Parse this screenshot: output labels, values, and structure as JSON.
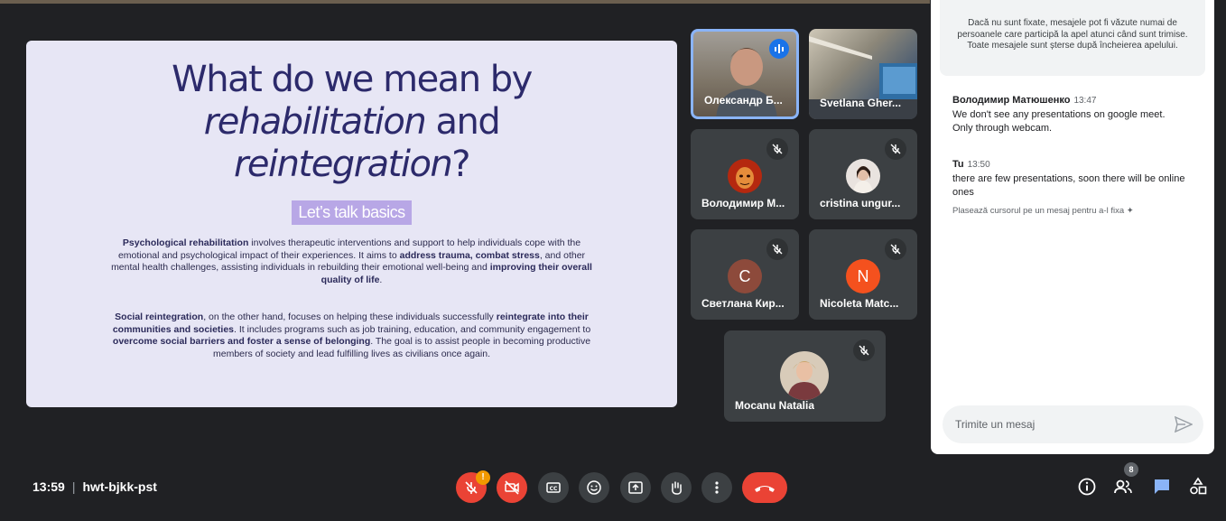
{
  "slide": {
    "title_line1": "What do we mean by",
    "title_line2_italic": "rehabilitation",
    "title_line2_rest": " and",
    "title_line3_italic": "reintegration",
    "title_line3_rest": "?",
    "subtitle": "Let’s talk basics",
    "p1": {
      "b1": "Psychological rehabilitation",
      "t1": " involves therapeutic interventions and support to help individuals cope with the emotional and psychological impact of their experiences. It aims to ",
      "b2": "address trauma, combat stress",
      "t2": ", and other mental health challenges, assisting individuals in rebuilding their emotional well-being and ",
      "b3": "improving their overall quality of life",
      "t3": "."
    },
    "p2": {
      "b1": "Social reintegration",
      "t1": ", on the other hand, focuses on helping these individuals successfully ",
      "b2": "reintegrate into their communities and societies",
      "t2": ". It includes programs such as job training, education, and community engagement to ",
      "b3": "overcome social barriers and foster a sense of belonging",
      "t3": ". The goal is to assist people in becoming productive members of society and lead fulfilling lives as civilians once again."
    }
  },
  "participants": [
    {
      "name": "Олександр Б...",
      "type": "video",
      "speaking": true
    },
    {
      "name": "Svetlana Gher...",
      "type": "video"
    },
    {
      "name": "Володимир М...",
      "type": "photo",
      "muted": true
    },
    {
      "name": "cristina ungur...",
      "type": "photo",
      "muted": true
    },
    {
      "name": "Светлана Кир...",
      "type": "initial",
      "initial": "C",
      "color": "#8d4a3b",
      "muted": true
    },
    {
      "name": "Nicoleta Matc...",
      "type": "initial",
      "initial": "N",
      "color": "#f4511e",
      "muted": true
    },
    {
      "name": "Mocanu Natalia",
      "type": "photo",
      "muted": true
    }
  ],
  "chat": {
    "notice": "Dacă nu sunt fixate, mesajele pot fi văzute numai de persoanele care participă la apel atunci când sunt trimise. Toate mesajele sunt șterse după încheierea apelului.",
    "messages": [
      {
        "sender": "Володимир Матюшенко",
        "time": "13:47",
        "lines": [
          "We don't see any presentations on google meet.",
          "Only through webcam."
        ]
      },
      {
        "sender": "Tu",
        "time": "13:50",
        "lines": [
          "there are few presentations, soon there will be online ones"
        ]
      }
    ],
    "pin_hint": "Plasează cursorul pe un mesaj pentru a-l fixa",
    "input_placeholder": "Trimite un mesaj"
  },
  "meeting": {
    "time": "13:59",
    "code": "hwt-bjkk-pst"
  },
  "controls": {
    "mic_warning": "!",
    "people_count": "8"
  },
  "colors": {
    "accent": "#8ab4f8",
    "danger": "#ea4335",
    "chat_active": "#8ab4f8"
  }
}
